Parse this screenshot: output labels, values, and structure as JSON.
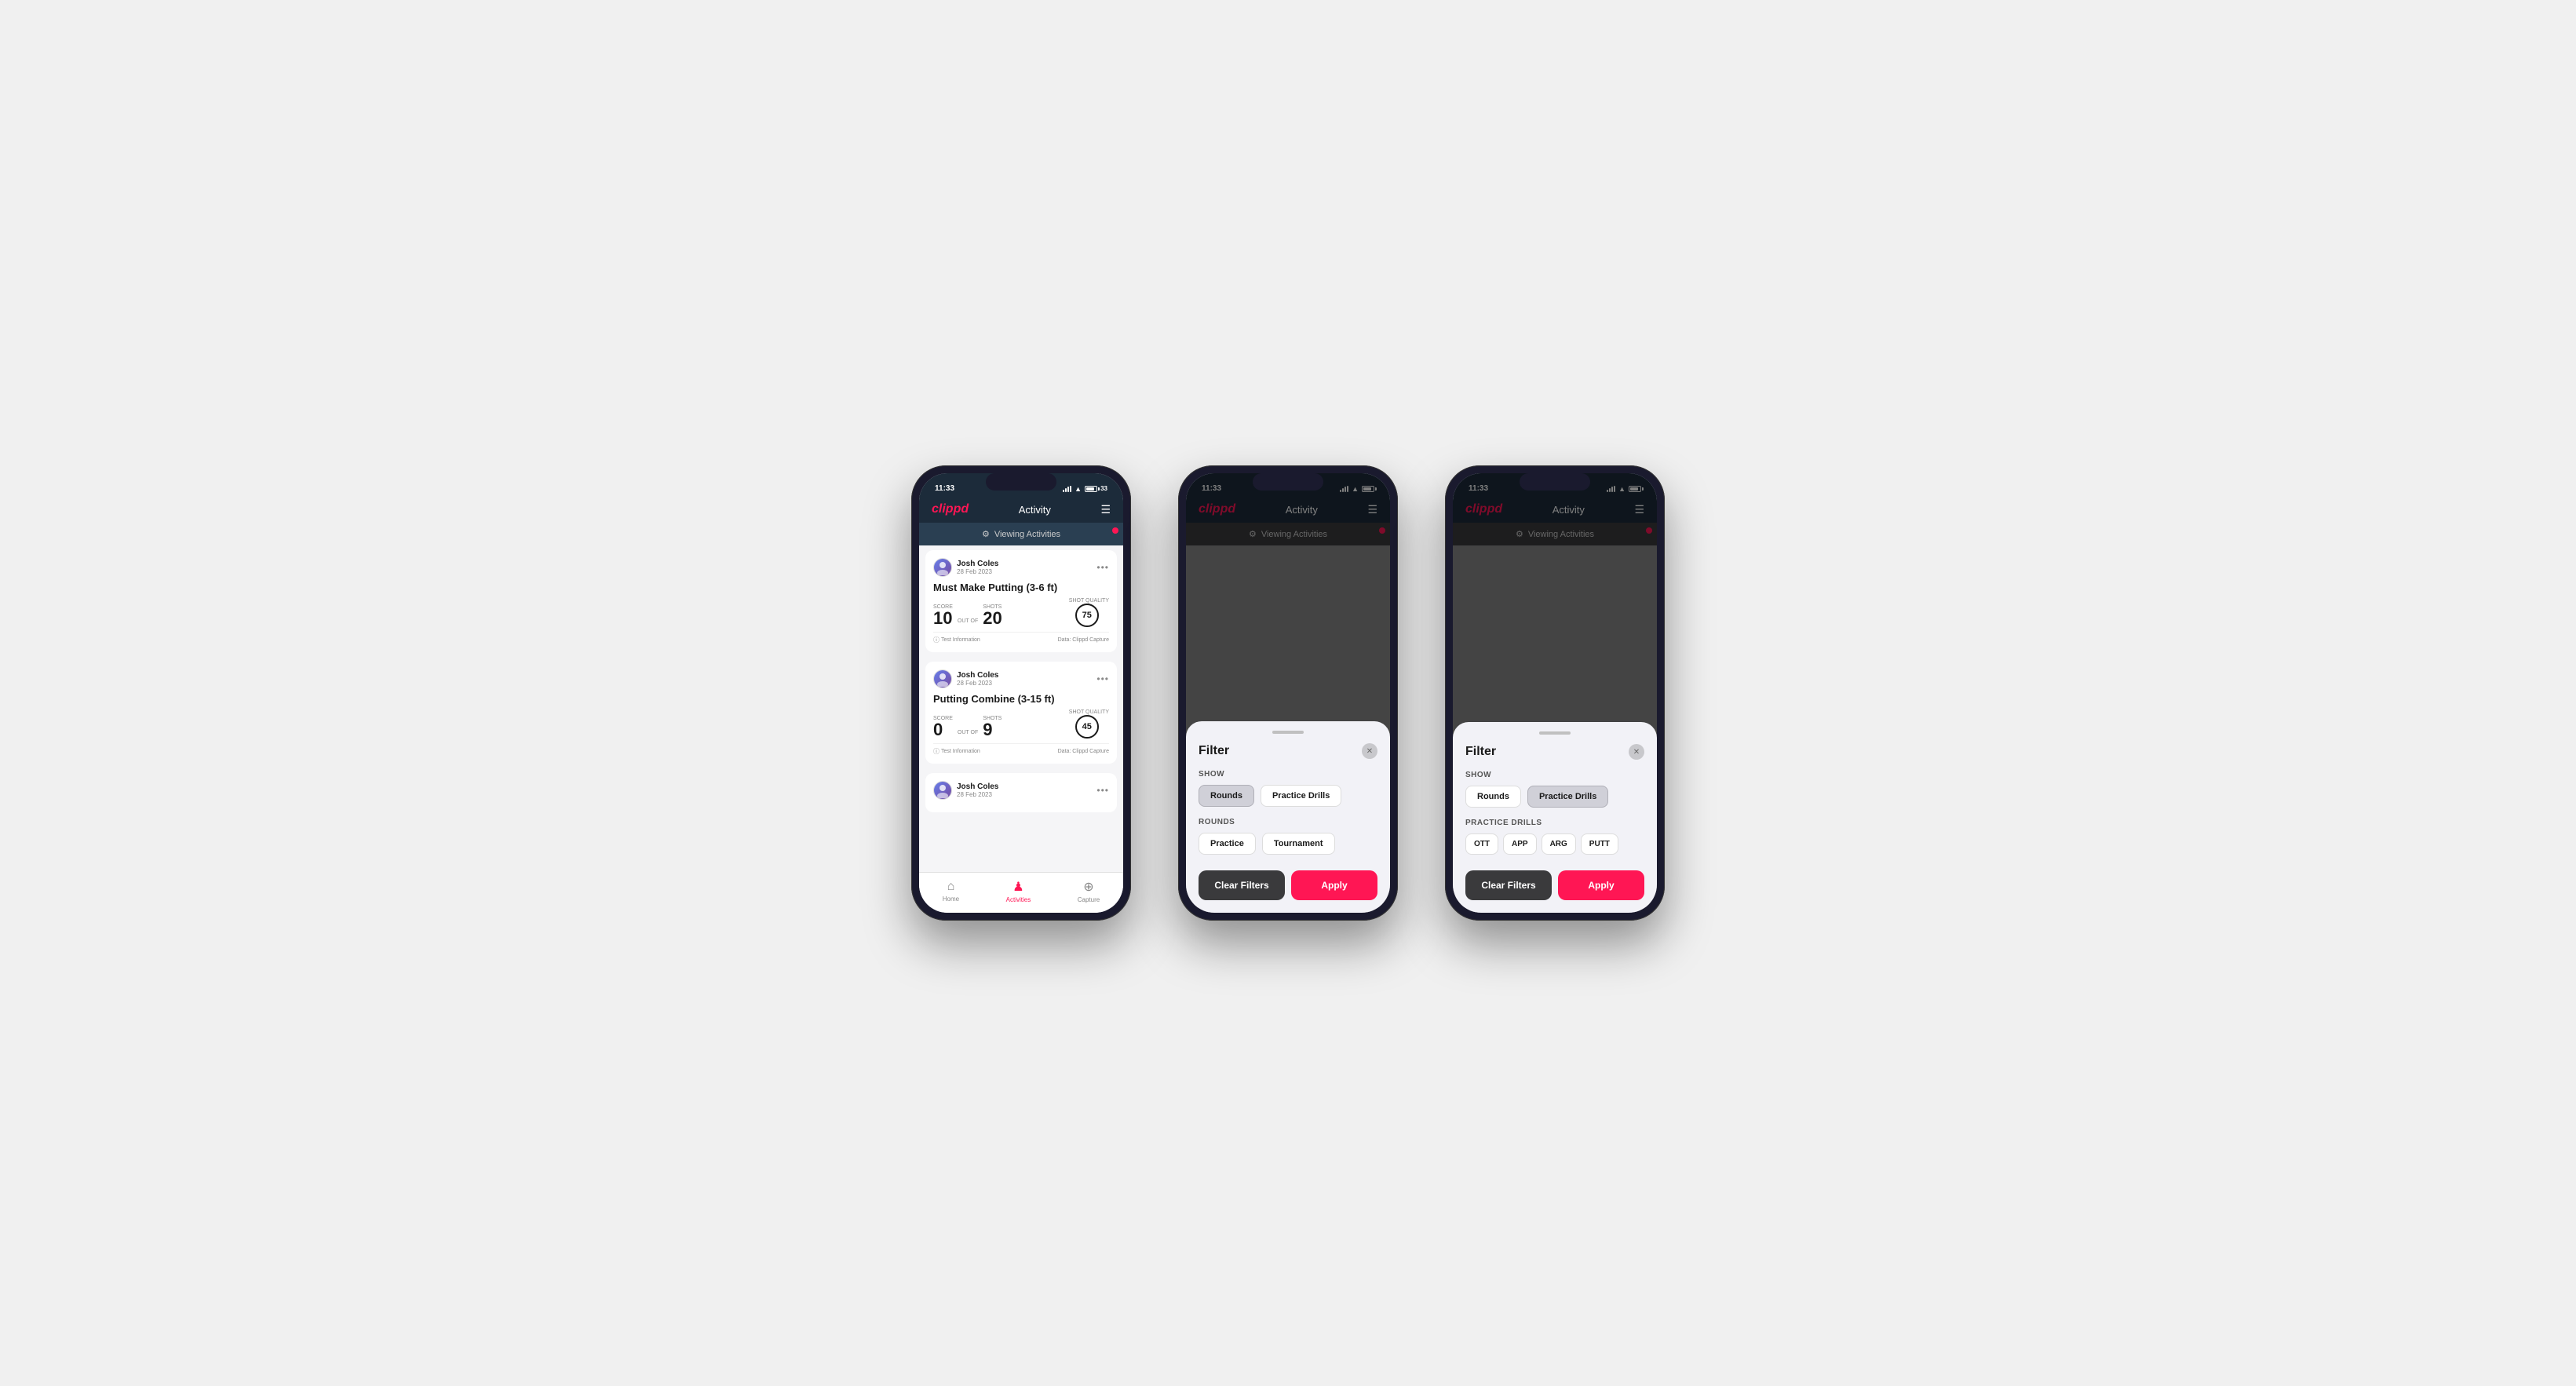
{
  "phone1": {
    "statusBar": {
      "time": "11:33",
      "batteryPercent": "33"
    },
    "header": {
      "logo": "clippd",
      "title": "Activity",
      "menuIcon": "☰"
    },
    "viewingBar": {
      "icon": "⚙",
      "text": "Viewing Activities"
    },
    "cards": [
      {
        "userName": "Josh Coles",
        "date": "28 Feb 2023",
        "title": "Must Make Putting (3-6 ft)",
        "scoreLbl": "Score",
        "score": "10",
        "outOf": "OUT OF",
        "shots": "20",
        "shotsLbl": "Shots",
        "shotQualityLbl": "Shot Quality",
        "shotQualityVal": "75",
        "footerInfo": "Test Information",
        "footerData": "Data: Clippd Capture"
      },
      {
        "userName": "Josh Coles",
        "date": "28 Feb 2023",
        "title": "Putting Combine (3-15 ft)",
        "scoreLbl": "Score",
        "score": "0",
        "outOf": "OUT OF",
        "shots": "9",
        "shotsLbl": "Shots",
        "shotQualityLbl": "Shot Quality",
        "shotQualityVal": "45",
        "footerInfo": "Test Information",
        "footerData": "Data: Clippd Capture"
      },
      {
        "userName": "Josh Coles",
        "date": "28 Feb 2023"
      }
    ],
    "nav": {
      "items": [
        {
          "icon": "⌂",
          "label": "Home",
          "active": false
        },
        {
          "icon": "♟",
          "label": "Activities",
          "active": true
        },
        {
          "icon": "⊕",
          "label": "Capture",
          "active": false
        }
      ]
    }
  },
  "phone2": {
    "statusBar": {
      "time": "11:33"
    },
    "header": {
      "logo": "clippd",
      "title": "Activity",
      "menuIcon": "☰"
    },
    "viewingBar": {
      "text": "Viewing Activities"
    },
    "filter": {
      "title": "Filter",
      "closeIcon": "✕",
      "showLabel": "Show",
      "showButtons": [
        {
          "label": "Rounds",
          "active": true
        },
        {
          "label": "Practice Drills",
          "active": false
        }
      ],
      "roundsLabel": "Rounds",
      "roundButtons": [
        {
          "label": "Practice",
          "active": false
        },
        {
          "label": "Tournament",
          "active": false
        }
      ],
      "clearLabel": "Clear Filters",
      "applyLabel": "Apply"
    }
  },
  "phone3": {
    "statusBar": {
      "time": "11:33"
    },
    "header": {
      "logo": "clippd",
      "title": "Activity",
      "menuIcon": "☰"
    },
    "viewingBar": {
      "text": "Viewing Activities"
    },
    "filter": {
      "title": "Filter",
      "closeIcon": "✕",
      "showLabel": "Show",
      "showButtons": [
        {
          "label": "Rounds",
          "active": false
        },
        {
          "label": "Practice Drills",
          "active": true
        }
      ],
      "drillsLabel": "Practice Drills",
      "drillButtons": [
        {
          "label": "OTT",
          "active": false
        },
        {
          "label": "APP",
          "active": false
        },
        {
          "label": "ARG",
          "active": false
        },
        {
          "label": "PUTT",
          "active": false
        }
      ],
      "clearLabel": "Clear Filters",
      "applyLabel": "Apply"
    }
  }
}
